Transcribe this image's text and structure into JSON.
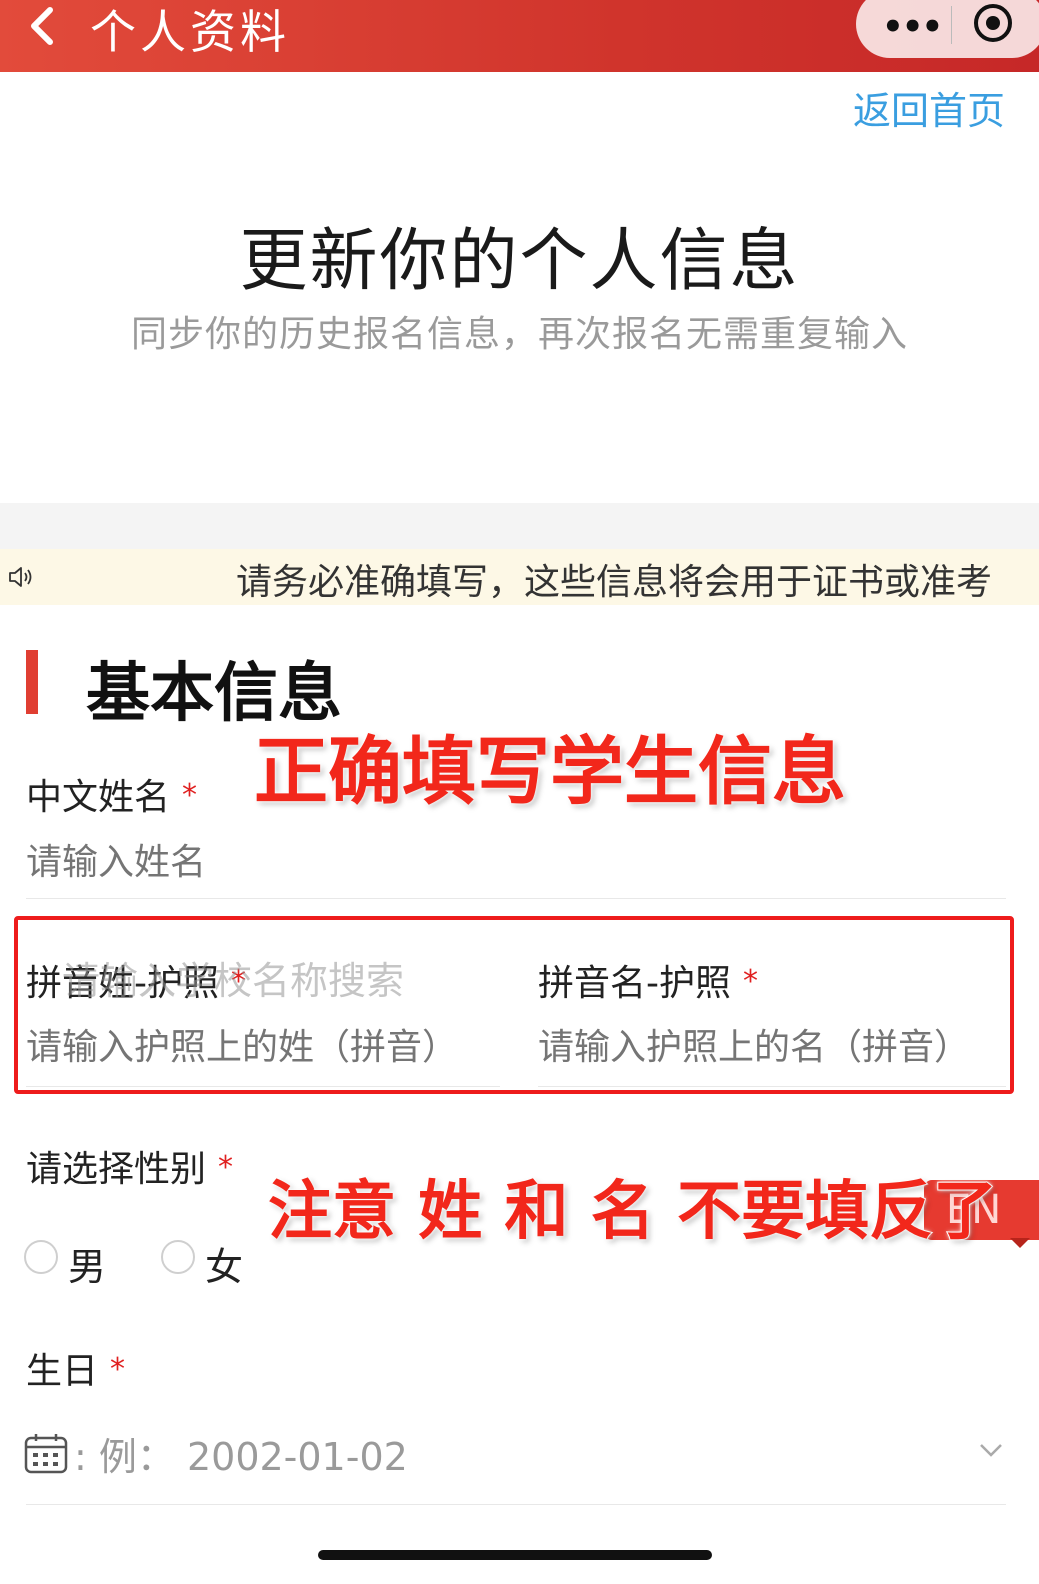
{
  "navbar": {
    "title": "个人资料",
    "more_icon": "more-dots-icon",
    "close_icon": "miniprogram-close-icon"
  },
  "home_link": "返回首页",
  "hero": {
    "title": "更新你的个人信息",
    "subtitle": "同步你的历史报名信息，再次报名无需重复输入"
  },
  "notice": {
    "icon": "speaker-icon",
    "text": "请务必准确填写，这些信息将会用于证书或准考"
  },
  "section": {
    "title": "基本信息"
  },
  "annotations": {
    "top": "正确填写学生信息",
    "bottom": "注意 姓 和 名 不要填反了"
  },
  "fields": {
    "chinese_name": {
      "label": "中文姓名",
      "required": "*",
      "placeholder": "请输入姓名"
    },
    "surname": {
      "label": "拼音姓-护照",
      "required": "*",
      "placeholder": "请输入护照上的姓（拼音）"
    },
    "given_name": {
      "label": "拼音名-护照",
      "required": "*",
      "placeholder": "请输入护照上的名（拼音）"
    },
    "ghost_search": "请输入学校名称搜索",
    "gender": {
      "label": "请选择性别",
      "required": "*",
      "options": [
        "男",
        "女"
      ]
    },
    "birthday": {
      "label": "生日",
      "required": "*",
      "value": ": 例： 2002-01-02"
    }
  },
  "lang_badge": "EN",
  "colors": {
    "navbar": "#d0342c",
    "accent": "#e03e32",
    "link": "#3a9ee0",
    "notice_bg": "#fdf8e6",
    "annotation": "#f2271b"
  }
}
